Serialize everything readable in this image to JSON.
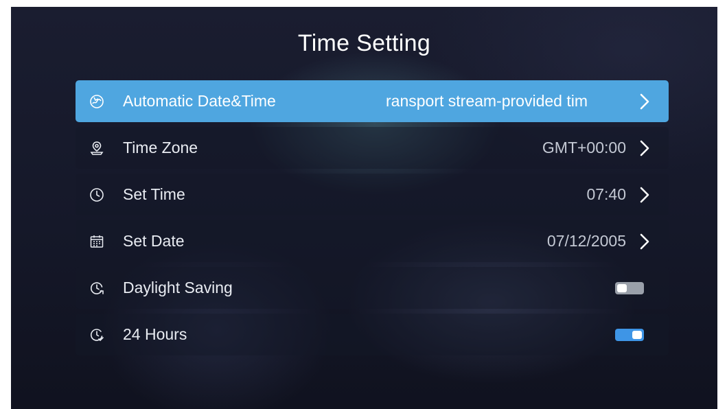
{
  "title": "Time Setting",
  "colors": {
    "selected_row": "#4fa6e0",
    "toggle_on": "#3e95e6",
    "toggle_off": "#9aa0aa"
  },
  "rows": [
    {
      "icon": "auto-time-globe-icon",
      "label": "Automatic Date&Time",
      "value": "ransport stream-provided tim",
      "selected": true
    },
    {
      "icon": "location-pin-icon",
      "label": "Time Zone",
      "value": "GMT+00:00"
    },
    {
      "icon": "clock-icon",
      "label": "Set Time",
      "value": "07:40"
    },
    {
      "icon": "calendar-icon",
      "label": "Set Date",
      "value": "07/12/2005"
    },
    {
      "icon": "daylight-clock-icon",
      "label": "Daylight Saving",
      "toggle": "off"
    },
    {
      "icon": "clock-check-icon",
      "label": "24 Hours",
      "toggle": "on"
    }
  ]
}
